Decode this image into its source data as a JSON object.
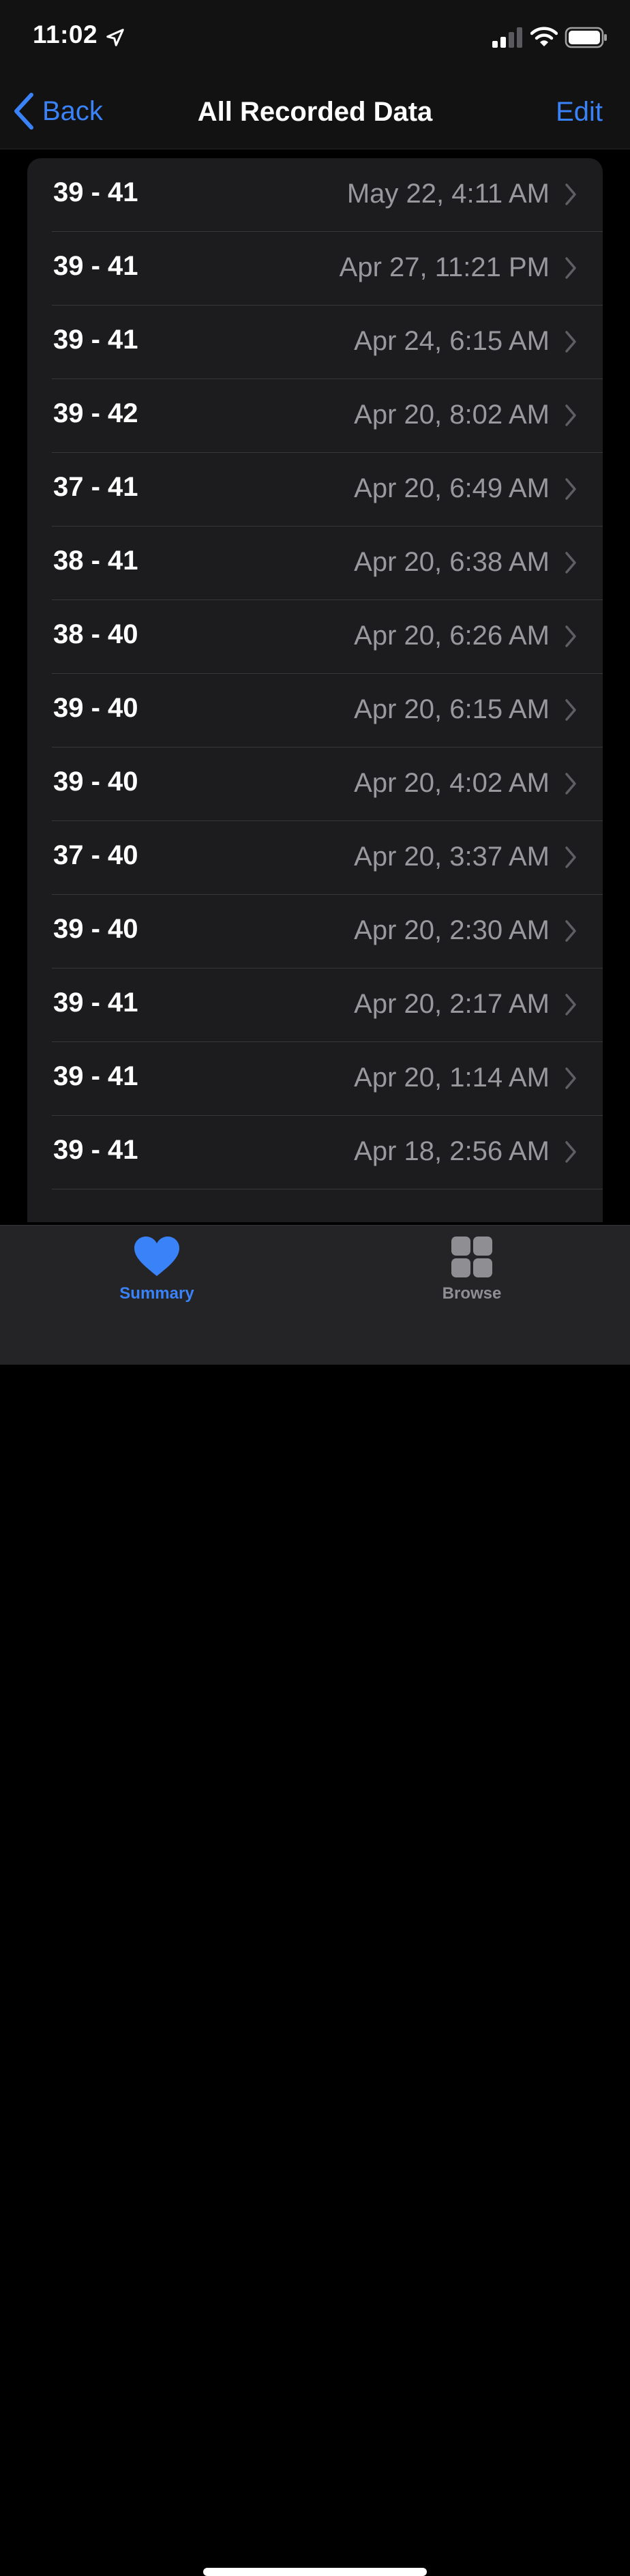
{
  "status_bar": {
    "time": "11:02",
    "location_icon": "location-arrow-icon",
    "signal_icon": "cellular-signal-icon",
    "wifi_icon": "wifi-icon",
    "battery_icon": "battery-icon"
  },
  "nav": {
    "back_label": "Back",
    "title": "All Recorded Data",
    "edit_label": "Edit"
  },
  "records": [
    {
      "value": "39 - 41",
      "date": "May 22, 4:11 AM"
    },
    {
      "value": "39 - 41",
      "date": "Apr 27, 11:21 PM"
    },
    {
      "value": "39 - 41",
      "date": "Apr 24, 6:15 AM"
    },
    {
      "value": "39 - 42",
      "date": "Apr 20, 8:02 AM"
    },
    {
      "value": "37 - 41",
      "date": "Apr 20, 6:49 AM"
    },
    {
      "value": "38 - 41",
      "date": "Apr 20, 6:38 AM"
    },
    {
      "value": "38 - 40",
      "date": "Apr 20, 6:26 AM"
    },
    {
      "value": "39 - 40",
      "date": "Apr 20, 6:15 AM"
    },
    {
      "value": "39 - 40",
      "date": "Apr 20, 4:02 AM"
    },
    {
      "value": "37 - 40",
      "date": "Apr 20, 3:37 AM"
    },
    {
      "value": "39 - 40",
      "date": "Apr 20, 2:30 AM"
    },
    {
      "value": "39 - 41",
      "date": "Apr 20, 2:17 AM"
    },
    {
      "value": "39 - 41",
      "date": "Apr 20, 1:14 AM"
    },
    {
      "value": "39 - 41",
      "date": "Apr 18, 2:56 AM"
    }
  ],
  "tabs": [
    {
      "label": "Summary",
      "icon": "heart-icon",
      "active": true
    },
    {
      "label": "Browse",
      "icon": "grid-icon",
      "active": false
    }
  ],
  "colors": {
    "accent": "#3a82f7",
    "background": "#000000",
    "card": "#1c1c1e",
    "secondary_text": "#98989d"
  }
}
